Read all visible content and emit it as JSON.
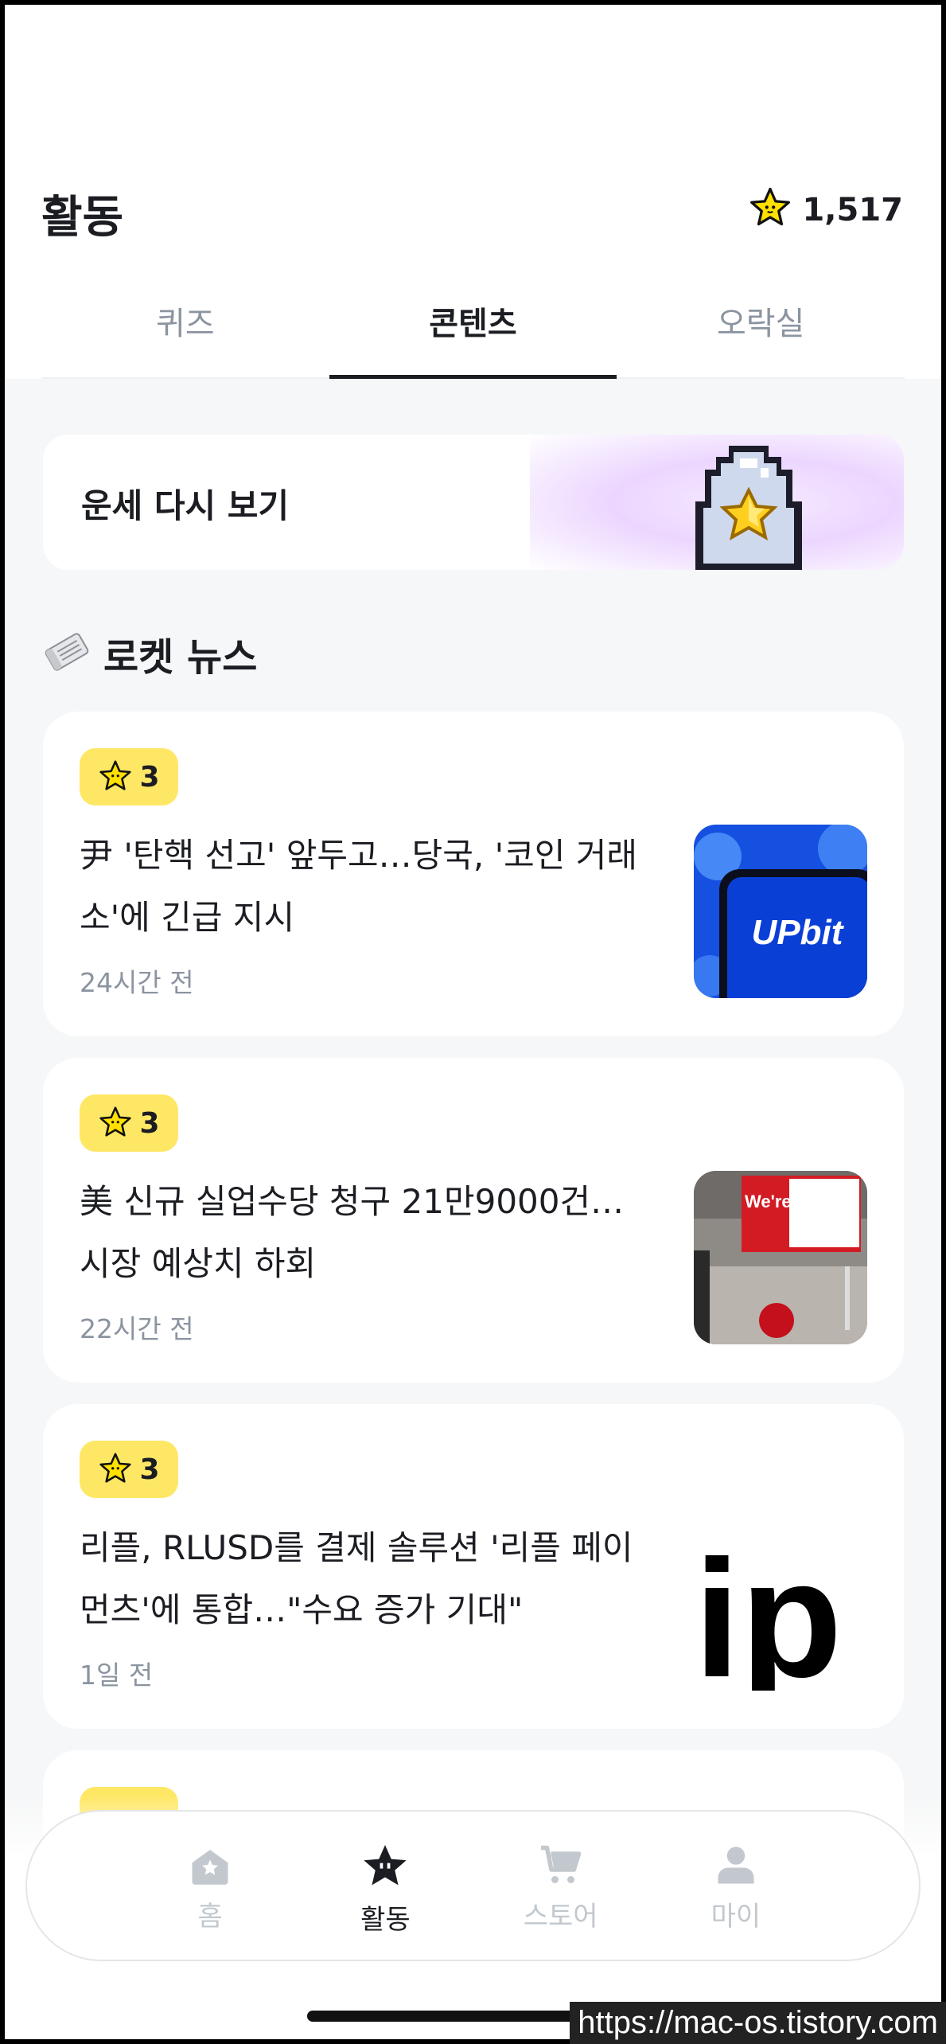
{
  "header": {
    "title": "활동",
    "points": "1,517"
  },
  "tabs": [
    {
      "label": "퀴즈",
      "active": false
    },
    {
      "label": "콘텐츠",
      "active": true
    },
    {
      "label": "오락실",
      "active": false
    }
  ],
  "fortune": {
    "label": "운세 다시 보기"
  },
  "section": {
    "title": "로켓 뉴스",
    "icon": "newspaper-icon"
  },
  "news": [
    {
      "reward": "3",
      "title": "尹 '탄핵 선고' 앞두고…당국, '코인 거래소'에 긴급 지시",
      "time": "24시간 전",
      "thumb_text": "UPbit"
    },
    {
      "reward": "3",
      "title": "美 신규 실업수당 청구 21만9000건…시장 예상치 하회",
      "time": "22시간 전",
      "thumb_text": "We're hiring."
    },
    {
      "reward": "3",
      "title": "리플, RLUSD를 결제 솔루션 '리플 페이먼츠'에 통합…\"수요 증가 기대\"",
      "time": "1일 전",
      "thumb_text": "ip"
    }
  ],
  "tabbar": [
    {
      "label": "홈",
      "icon": "home-icon",
      "active": false
    },
    {
      "label": "활동",
      "icon": "star-icon",
      "active": true
    },
    {
      "label": "스토어",
      "icon": "cart-icon",
      "active": false
    },
    {
      "label": "마이",
      "icon": "person-icon",
      "active": false
    }
  ],
  "watermark": "https://mac-os.tistory.com",
  "colors": {
    "badge": "#ffe766",
    "text": "#1b1d22",
    "muted": "#8b94a0",
    "upbit_blue": "#0a3fd6"
  }
}
